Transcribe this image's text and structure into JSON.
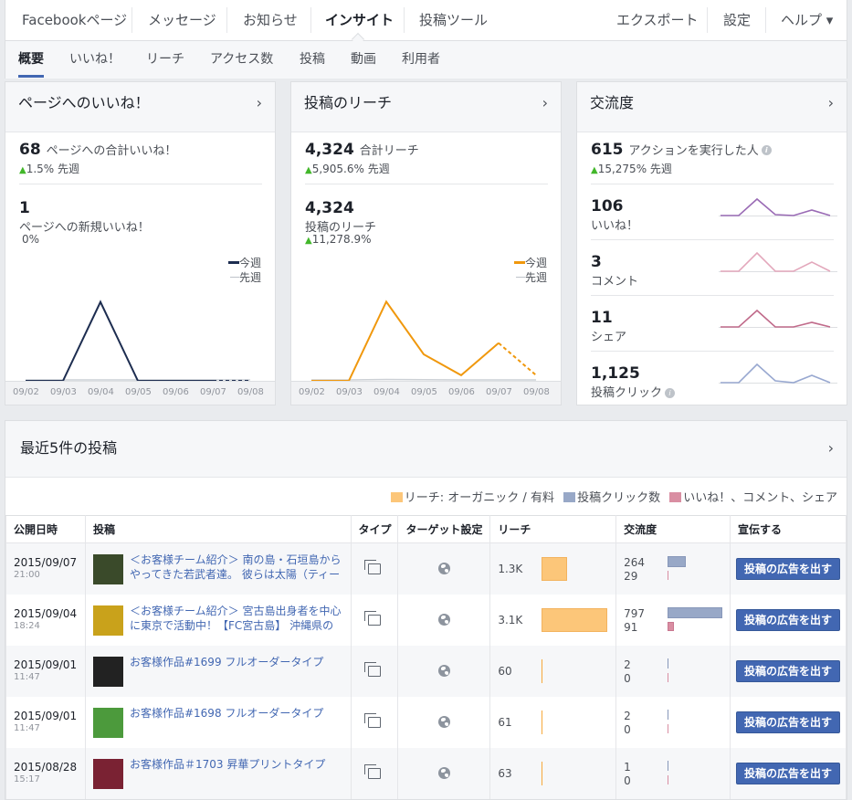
{
  "topnav": {
    "items": [
      "Facebookページ",
      "メッセージ",
      "お知らせ",
      "インサイト",
      "投稿ツール"
    ],
    "right": [
      "エクスポート",
      "設定",
      "ヘルプ ▾"
    ]
  },
  "subnav": {
    "items": [
      "概要",
      "いいね！",
      "リーチ",
      "アクセス数",
      "投稿",
      "動画",
      "利用者"
    ]
  },
  "likes_card": {
    "title": "ページへのいいね！",
    "total": "68",
    "total_label": "ページへの合計いいね！",
    "total_change": "1.5%",
    "period": "先週",
    "new": "1",
    "new_label": "ページへの新規いいね！",
    "new_change": "0%",
    "legend_this": "今週",
    "legend_last": "先週",
    "color": "#1d2d50"
  },
  "reach_card": {
    "title": "投稿のリーチ",
    "total": "4,324",
    "total_label": "合計リーチ",
    "total_change": "5,905.6%",
    "period": "先週",
    "post": "4,324",
    "post_label": "投稿のリーチ",
    "post_change": "11,278.9%",
    "legend_this": "今週",
    "legend_last": "先週",
    "color": "#f0980d"
  },
  "engage_card": {
    "title": "交流度",
    "total": "615",
    "total_label": "アクションを実行した人",
    "total_change": "15,275%",
    "period": "先週",
    "rows": [
      {
        "value": "106",
        "label": "いいね！",
        "color": "#9a6bb5",
        "spark": [
          0,
          0,
          18,
          1,
          0,
          6,
          0
        ]
      },
      {
        "value": "3",
        "label": "コメント",
        "color": "#e3a8bc",
        "spark": [
          0,
          0,
          20,
          0,
          0,
          10,
          0
        ]
      },
      {
        "value": "11",
        "label": "シェア",
        "color": "#c06a8a",
        "spark": [
          0,
          0,
          18,
          0,
          0,
          5,
          0
        ]
      },
      {
        "value": "1,125",
        "label": "投稿クリック",
        "color": "#98a8d0",
        "spark": [
          0,
          0,
          20,
          2,
          0,
          8,
          0
        ]
      }
    ]
  },
  "chart_data": [
    {
      "type": "line",
      "title": "ページへのいいね！",
      "x": [
        "09/02",
        "09/03",
        "09/04",
        "09/05",
        "09/06",
        "09/07",
        "09/08"
      ],
      "series": [
        {
          "name": "今週",
          "values": [
            0,
            0,
            1,
            0,
            0,
            0,
            0
          ]
        },
        {
          "name": "先週",
          "values": [
            0,
            0,
            0,
            0,
            0,
            0,
            0
          ]
        }
      ],
      "ylim": [
        0,
        1.1
      ]
    },
    {
      "type": "line",
      "title": "投稿のリーチ",
      "x": [
        "09/02",
        "09/03",
        "09/04",
        "09/05",
        "09/06",
        "09/07",
        "09/08"
      ],
      "series": [
        {
          "name": "今週",
          "values": [
            0,
            0,
            1550,
            520,
            110,
            740,
            110
          ]
        },
        {
          "name": "先週",
          "values": [
            0,
            0,
            8,
            5,
            0,
            0,
            0
          ]
        }
      ],
      "ylim": [
        0,
        1700
      ]
    }
  ],
  "posts": {
    "title": "最近5件の投稿",
    "legend": [
      "リーチ: オーガニック / 有料",
      "投稿クリック数",
      "いいね！、コメント、シェア"
    ],
    "legend_colors": [
      "#fcc679",
      "#98a8c7",
      "#d98ea2"
    ],
    "headers": [
      "公開日時",
      "投稿",
      "タイプ",
      "ターゲット設定",
      "リーチ",
      "交流度",
      "宣伝する"
    ],
    "boost_label": "投稿の広告を出す",
    "rows": [
      {
        "date": "2015/09/07",
        "time": "21:00",
        "text": "＜お客様チーム紹介＞ 南の島・石垣島からやってきた若武者達。 彼らは太陽（ティー",
        "reach": "1.3K",
        "reach_frac": 0.39,
        "clicks": "264",
        "reactions": "29",
        "clicks_frac": 0.33,
        "react_frac": 0.04,
        "thumb": "#3a4a2a"
      },
      {
        "date": "2015/09/04",
        "time": "18:24",
        "text": "＜お客様チーム紹介＞ 宮古島出身者を中心に東京で活動中！【FC宮古島】 沖縄県の",
        "reach": "3.1K",
        "reach_frac": 1.0,
        "clicks": "797",
        "reactions": "91",
        "clicks_frac": 1.0,
        "react_frac": 0.11,
        "thumb": "#c9a21b"
      },
      {
        "date": "2015/09/01",
        "time": "11:47",
        "text": "お客様作品#1699 フルオーダータイプ",
        "reach": "60",
        "reach_frac": 0.01,
        "clicks": "2",
        "reactions": "0",
        "clicks_frac": 0.0,
        "react_frac": 0.0,
        "thumb": "#222222"
      },
      {
        "date": "2015/09/01",
        "time": "11:47",
        "text": "お客様作品#1698 フルオーダータイプ",
        "reach": "61",
        "reach_frac": 0.01,
        "clicks": "2",
        "reactions": "0",
        "clicks_frac": 0.0,
        "react_frac": 0.0,
        "thumb": "#4c9a3c"
      },
      {
        "date": "2015/08/28",
        "time": "15:17",
        "text": "お客様作品＃1703 昇華プリントタイプ",
        "reach": "63",
        "reach_frac": 0.01,
        "clicks": "1",
        "reactions": "0",
        "clicks_frac": 0.0,
        "react_frac": 0.0,
        "thumb": "#7a2233"
      }
    ]
  }
}
